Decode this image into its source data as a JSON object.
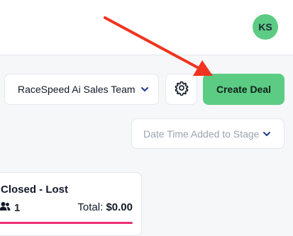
{
  "header": {
    "avatar_initials": "KS"
  },
  "toolbar": {
    "team_select_value": "RaceSpeed Ai Sales Team",
    "create_deal_label": "Create Deal",
    "sort_select_value": "Date Time Added to Stage"
  },
  "stage": {
    "title": "Closed - Lost",
    "count": "1",
    "total_label": "Total:",
    "total_value": "$0.00"
  },
  "colors": {
    "accent_green": "#5ccc84",
    "lost_bar": "#ec2f73",
    "annotation_arrow": "#f0341f"
  },
  "icons": {
    "settings": "gear-icon",
    "dropdown": "chevron-down-icon",
    "people": "users-icon"
  }
}
